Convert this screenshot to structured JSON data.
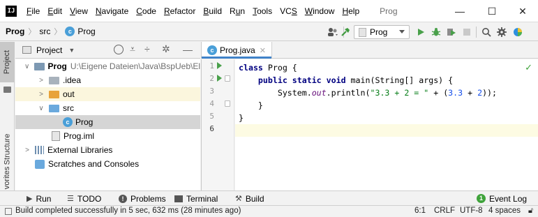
{
  "menubar": {
    "logo_text": "IJ",
    "items": [
      {
        "pre": "",
        "ul": "F",
        "post": "ile"
      },
      {
        "pre": "",
        "ul": "E",
        "post": "dit"
      },
      {
        "pre": "",
        "ul": "V",
        "post": "iew"
      },
      {
        "pre": "",
        "ul": "N",
        "post": "avigate"
      },
      {
        "pre": "",
        "ul": "C",
        "post": "ode"
      },
      {
        "pre": "",
        "ul": "R",
        "post": "efactor"
      },
      {
        "pre": "",
        "ul": "B",
        "post": "uild"
      },
      {
        "pre": "R",
        "ul": "u",
        "post": "n"
      },
      {
        "pre": "",
        "ul": "T",
        "post": "ools"
      },
      {
        "pre": "VC",
        "ul": "S",
        "post": ""
      },
      {
        "pre": "",
        "ul": "W",
        "post": "indow"
      },
      {
        "pre": "",
        "ul": "H",
        "post": "elp"
      }
    ],
    "title": "Prog",
    "window_buttons": {
      "minimize": "—",
      "maximize": "☐",
      "close": "✕"
    }
  },
  "navbar": {
    "breadcrumbs": [
      "Prog",
      "src",
      "Prog"
    ],
    "run_config": "Prog"
  },
  "left_strip": {
    "tabs": [
      "Project",
      "Structure",
      "vorites"
    ]
  },
  "project_panel": {
    "title": "Project",
    "tree": [
      {
        "label": "Prog",
        "path": "U:\\Eigene Dateien\\Java\\BspUeb\\El",
        "chevron": "∨",
        "icon": "module",
        "bold": true
      },
      {
        "label": ".idea",
        "chevron": ">",
        "icon": "folder-gray"
      },
      {
        "label": "out",
        "chevron": ">",
        "icon": "folder-orange"
      },
      {
        "label": "src",
        "chevron": "∨",
        "icon": "folder-blue"
      },
      {
        "label": "Prog",
        "chevron": "",
        "icon": "class"
      },
      {
        "label": "Prog.iml",
        "chevron": "",
        "icon": "iml"
      },
      {
        "label": "External Libraries",
        "chevron": ">",
        "icon": "libraries"
      },
      {
        "label": "Scratches and Consoles",
        "chevron": "",
        "icon": "scratches"
      }
    ]
  },
  "editor": {
    "tab_label": "Prog.java",
    "line_numbers": [
      "1",
      "2",
      "3",
      "4",
      "5",
      "6"
    ],
    "code": {
      "l1_kw": "class",
      "l1_rest": " Prog {",
      "l2_indent": "    ",
      "l2_kw": "public static void",
      "l2_rest": " main(String[] args) {",
      "l3_pre": "        System.",
      "l3_it": "out",
      "l3_mid": ".println(",
      "l3_str": "\"3.3 + 2 = \"",
      "l3_plus": " + (",
      "l3_n1": "3.3",
      "l3_op": " + ",
      "l3_n2": "2",
      "l3_end": "));",
      "l4": "    }",
      "l5": "}",
      "l6": ""
    }
  },
  "bottom_bar": {
    "run": "Run",
    "todo": "TODO",
    "problems": "Problems",
    "terminal": "Terminal",
    "build": "Build",
    "event_log": "Event Log",
    "event_log_badge": "1"
  },
  "status_bar": {
    "message": "Build completed successfully in 5 sec, 632 ms (28 minutes ago)",
    "position": "6:1",
    "line_sep": "CRLF",
    "encoding": "UTF-8",
    "indent": "4 spaces"
  },
  "colors": {
    "accent": "#4083c9",
    "run_green": "#49a04a",
    "keyword": "#000080",
    "string": "#067d17",
    "number": "#1750eb"
  }
}
